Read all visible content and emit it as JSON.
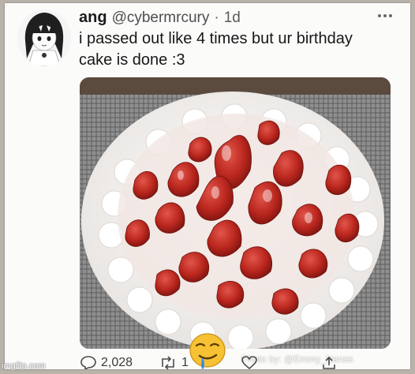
{
  "tweet": {
    "display_name": "ang",
    "handle": "@cybermrcury",
    "separator": "·",
    "timestamp": "1d",
    "text_lines": [
      "i passed out like 4 times but ur birthday",
      "cake is done :3"
    ],
    "reply_count": "2,028",
    "retweet_count": "1",
    "media_watermark": "Photo by: @Emmy_Nanas"
  },
  "icons": {
    "avatar": "anime-girl-avatar",
    "more": "more-dots-icon",
    "reply": "reply-icon",
    "retweet": "retweet-icon",
    "like": "like-icon",
    "share": "share-icon",
    "overlay_emoji": "drooling-face-emoji"
  },
  "colors": {
    "text": "#171717",
    "muted": "#4d4d4d",
    "cake_cream": "#f7f5f4",
    "strawberry": "#b9261d",
    "emoji_yellow": "#f6c234",
    "drool": "#3b8fe0"
  },
  "site_watermark": "imgflip.com"
}
